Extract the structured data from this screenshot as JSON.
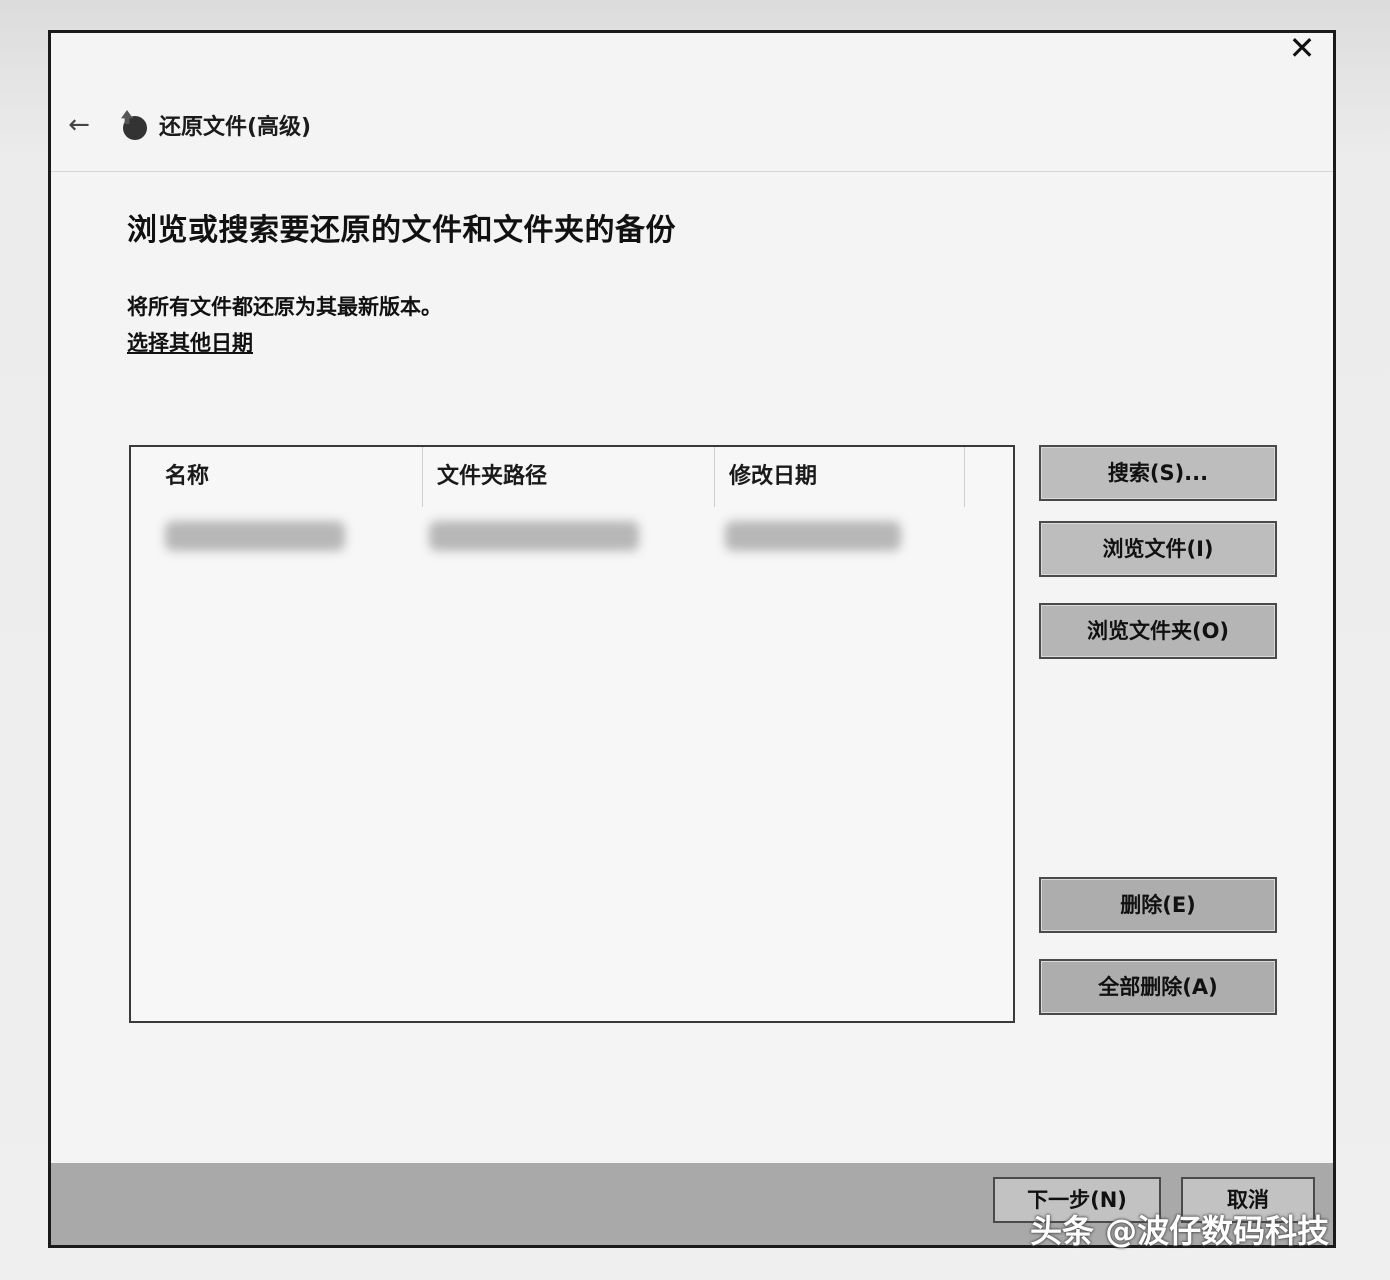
{
  "window": {
    "title": "还原文件(高级)",
    "close_glyph": "✕",
    "back_glyph": "←"
  },
  "main": {
    "heading": "浏览或搜索要还原的文件和文件夹的备份",
    "info": "将所有文件都还原为其最新版本。",
    "choose_date_link": "选择其他日期"
  },
  "table": {
    "columns": [
      "名称",
      "文件夹路径",
      "修改日期"
    ],
    "rows": [
      {
        "blurred": true
      }
    ]
  },
  "side_buttons": {
    "search": "搜索(S)...",
    "browse_files": "浏览文件(I)",
    "browse_folders": "浏览文件夹(O)",
    "remove": "删除(E)",
    "remove_all": "全部删除(A)"
  },
  "footer": {
    "next": "下一步(N)",
    "cancel": "取消"
  },
  "watermark": "头条 @波仔数码科技"
}
